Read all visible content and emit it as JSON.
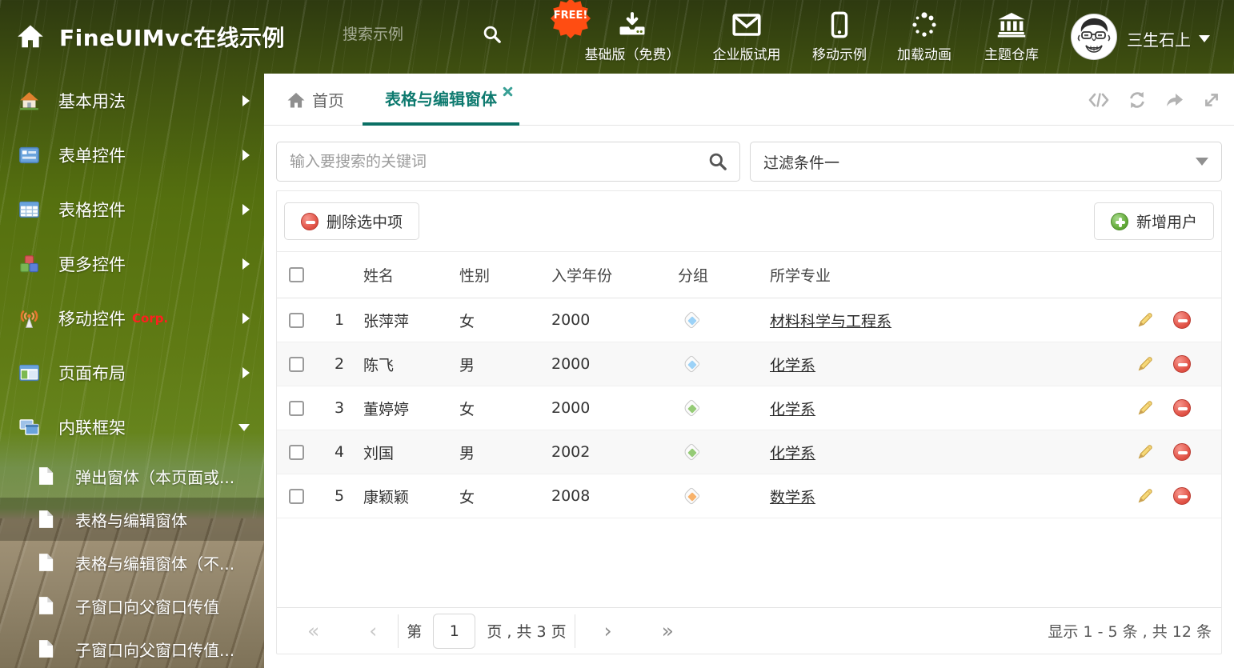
{
  "header": {
    "title": "FineUIMvc在线示例",
    "search_placeholder": "搜索示例",
    "free_badge": "FREE!",
    "nav_items": [
      {
        "label": "基础版（免费）"
      },
      {
        "label": "企业版试用"
      },
      {
        "label": "移动示例"
      },
      {
        "label": "加载动画"
      },
      {
        "label": "主题仓库"
      }
    ],
    "username": "三生石上"
  },
  "sidebar": {
    "items": [
      {
        "label": "基本用法"
      },
      {
        "label": "表单控件"
      },
      {
        "label": "表格控件"
      },
      {
        "label": "更多控件"
      },
      {
        "label": "移动控件",
        "badge": "Corp."
      },
      {
        "label": "页面布局"
      },
      {
        "label": "内联框架"
      }
    ],
    "subitems": [
      {
        "label": "弹出窗体（本页面或..."
      },
      {
        "label": "表格与编辑窗体"
      },
      {
        "label": "表格与编辑窗体（不..."
      },
      {
        "label": "子窗口向父窗口传值"
      },
      {
        "label": "子窗口向父窗口传值..."
      }
    ]
  },
  "tabs": {
    "home": "首页",
    "active": "表格与编辑窗体"
  },
  "main": {
    "search_placeholder": "输入要搜索的关键词",
    "filter_value": "过滤条件一",
    "delete_button": "删除选中项",
    "add_button": "新增用户"
  },
  "table": {
    "columns": [
      "姓名",
      "性别",
      "入学年份",
      "分组",
      "所学专业"
    ],
    "rows": [
      {
        "index": "1",
        "name": "张萍萍",
        "gender": "女",
        "year": "2000",
        "tag_color": "#9cd2f7",
        "major": "材料科学与工程系"
      },
      {
        "index": "2",
        "name": "陈飞",
        "gender": "男",
        "year": "2000",
        "tag_color": "#9cd2f7",
        "major": "化学系"
      },
      {
        "index": "3",
        "name": "董婷婷",
        "gender": "女",
        "year": "2000",
        "tag_color": "#95cb76",
        "major": "化学系"
      },
      {
        "index": "4",
        "name": "刘国",
        "gender": "男",
        "year": "2002",
        "tag_color": "#95cb76",
        "major": "化学系"
      },
      {
        "index": "5",
        "name": "康颖颖",
        "gender": "女",
        "year": "2008",
        "tag_color": "#f8b26a",
        "major": "数学系"
      }
    ]
  },
  "pagination": {
    "first": "«",
    "prev": "‹",
    "next": "›",
    "last": "»",
    "page_prefix": "第",
    "page_value": "1",
    "page_suffix": "页 , 共 3 页",
    "summary": "显示 1 - 5 条 , 共 12 条"
  },
  "colors": {
    "accent": "#0e7a6f"
  }
}
